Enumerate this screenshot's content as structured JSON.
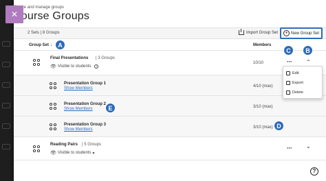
{
  "header": {
    "close_icon": "close-icon",
    "subtitle": "Create and manage groups",
    "title": "Course Groups"
  },
  "toolbar": {
    "sets_count": "2 Sets | 8 Groups",
    "import_label": "Import Group Set",
    "new_group_label": "New Group Set"
  },
  "columns": {
    "group_set": "Group Set",
    "members": "Members"
  },
  "group_sets": [
    {
      "name": "Final Presentations",
      "count": "3 Groups",
      "visibility": "Visible to students",
      "members": "10/10",
      "groups": [
        {
          "name": "Presentation Group 1",
          "link": "Show Members",
          "members": "4/10 (max)"
        },
        {
          "name": "Presentation Group 2",
          "link": "Show Members",
          "members": "3/10 (max)"
        },
        {
          "name": "Presentation Group 3",
          "link": "Show Members",
          "members": "3/10 (max)"
        }
      ]
    },
    {
      "name": "Reading Pairs",
      "count": "5 Groups",
      "visibility": "Visible to students"
    }
  ],
  "menu": {
    "edit": "Edit",
    "export": "Export",
    "delete": "Delete"
  },
  "callouts": {
    "a": "A",
    "b": "B",
    "c": "C",
    "d": "D",
    "e": "E"
  },
  "colors": {
    "accent": "#2c6bb8",
    "close_tab": "#b07bbf"
  },
  "icons": {
    "help": "?"
  }
}
